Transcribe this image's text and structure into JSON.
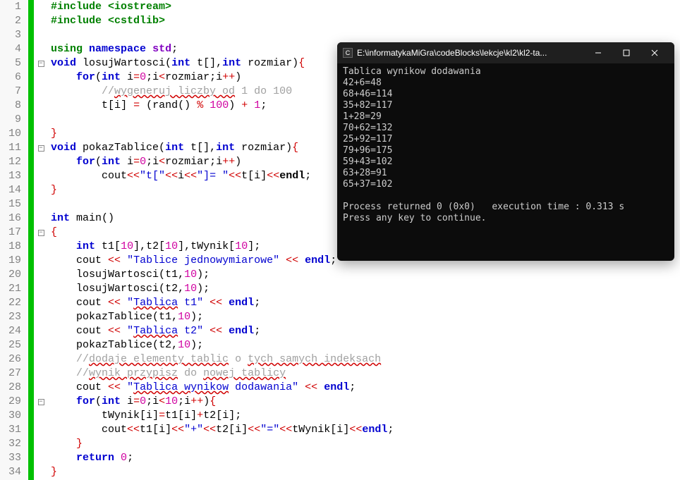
{
  "editor": {
    "lines": [
      1,
      2,
      3,
      4,
      5,
      6,
      7,
      8,
      9,
      10,
      11,
      12,
      13,
      14,
      15,
      16,
      17,
      18,
      19,
      20,
      21,
      22,
      23,
      24,
      25,
      26,
      27,
      28,
      29,
      30,
      31,
      32,
      33,
      34
    ],
    "folds": {
      "5": "−",
      "11": "−",
      "17": "−",
      "29": "−"
    },
    "code": {
      "l1_include": "#include",
      "l1_lib": "<iostream>",
      "l2_include": "#include",
      "l2_lib": "<cstdlib>",
      "l4_using": "using",
      "l4_ns": "namespace",
      "l4_std": "std",
      "l4_semi": ";",
      "l5_void": "void",
      "l5_fn": " losujWartosci",
      "l5_p1": "(",
      "l5_int1": "int",
      "l5_t": " t",
      "l5_br": "[],",
      "l5_int2": "int",
      "l5_rozmiar": " rozmiar",
      "l5_p2": ")",
      "l5_brace": "{",
      "l6_for": "for",
      "l6_p1": "(",
      "l6_int": "int",
      "l6_body": " i",
      "l6_eq": "=",
      "l6_z": "0",
      "l6_semi1": ";",
      "l6_cond": "i",
      "l6_lt": "<",
      "l6_roz": "rozmiar",
      "l6_semi2": ";",
      "l6_inc": "i",
      "l6_pp": "++",
      "l6_p2": ")",
      "l7_comment": "//wygeneruj liczby od 1 do 100",
      "l7_wavy": "wygeneruj liczby od",
      "l8_t": "t",
      "l8_br1": "[",
      "l8_i": "i",
      "l8_br2": "]",
      "l8_sp": " ",
      "l8_eq": "=",
      "l8_sp2": " ",
      "l8_p1": "(",
      "l8_rand": "rand",
      "l8_p2": "()",
      "l8_sp3": " ",
      "l8_mod": "%",
      "l8_sp4": " ",
      "l8_100": "100",
      "l8_p3": ")",
      "l8_sp5": " ",
      "l8_plus": "+",
      "l8_sp6": " ",
      "l8_1": "1",
      "l8_semi": ";",
      "l10_brace": "}",
      "l11_void": "void",
      "l11_fn": " pokazTablice",
      "l11_p1": "(",
      "l11_int1": "int",
      "l11_t": " t",
      "l11_br": "[],",
      "l11_int2": "int",
      "l11_roz": " rozmiar",
      "l11_p2": ")",
      "l11_brace": "{",
      "l12_for": "for",
      "l12_p1": "(",
      "l12_int": "int",
      "l12_body": " i",
      "l12_eq": "=",
      "l12_z": "0",
      "l12_semi1": ";",
      "l12_cond": "i",
      "l12_lt": "<",
      "l12_roz": "rozmiar",
      "l12_semi2": ";",
      "l12_inc": "i",
      "l12_pp": "++",
      "l12_p2": ")",
      "l13_cout": "cout",
      "l13_op1": "<<",
      "l13_s1": "\"t[\"",
      "l13_op2": "<<",
      "l13_i": "i",
      "l13_op3": "<<",
      "l13_s2": "\"]= \"",
      "l13_op4": "<<",
      "l13_t": "t",
      "l13_br1": "[",
      "l13_ii": "i",
      "l13_br2": "]",
      "l13_op5": "<<",
      "l13_endl": "endl",
      "l13_semi": ";",
      "l14_brace": "}",
      "l16_int": "int",
      "l16_main": " main",
      "l16_p": "()",
      "l17_brace": "{",
      "l18_int": "int",
      "l18_t1": " t1",
      "l18_b1": "[",
      "l18_10a": "10",
      "l18_b2": "],",
      "l18_t2": "t2",
      "l18_b3": "[",
      "l18_10b": "10",
      "l18_b4": "],",
      "l18_tw": "tWynik",
      "l18_b5": "[",
      "l18_10c": "10",
      "l18_b6": "];",
      "l19_cout": "cout",
      "l19_sp": " ",
      "l19_op1": "<<",
      "l19_sp2": " ",
      "l19_s": "\"Tablice jednowymiarowe\"",
      "l19_sp3": " ",
      "l19_op2": "<<",
      "l19_sp4": " ",
      "l19_endl": "endl",
      "l19_semi": ";",
      "l20_fn": "losujWartosci",
      "l20_p1": "(",
      "l20_t1": "t1",
      "l20_c": ",",
      "l20_10": "10",
      "l20_p2": ");",
      "l21_fn": "losujWartosci",
      "l21_p1": "(",
      "l21_t2": "t2",
      "l21_c": ",",
      "l21_10": "10",
      "l21_p2": ");",
      "l22_cout": "cout",
      "l22_sp": " ",
      "l22_op1": "<<",
      "l22_sp2": " ",
      "l22_s": "\"Tablica t1\"",
      "l22_wavy": "Tablica",
      "l22_sp3": " ",
      "l22_op2": "<<",
      "l22_sp4": " ",
      "l22_endl": "endl",
      "l22_semi": ";",
      "l23_fn": "pokazTablice",
      "l23_p1": "(",
      "l23_t": "t1",
      "l23_c": ",",
      "l23_10": "10",
      "l23_p2": ");",
      "l24_cout": "cout",
      "l24_sp": " ",
      "l24_op1": "<<",
      "l24_sp2": " ",
      "l24_s": "\"Tablica t2\"",
      "l24_sp3": " ",
      "l24_op2": "<<",
      "l24_sp4": " ",
      "l24_endl": "endl",
      "l24_semi": ";",
      "l25_fn": "pokazTablice",
      "l25_p1": "(",
      "l25_t": "t2",
      "l25_c": ",",
      "l25_10": "10",
      "l25_p2": ");",
      "l26_c": "//dodaje elementy tablic o tych samych indeksach",
      "l27_c": "//wynik przypisz do nowej tablicy",
      "l28_cout": "cout",
      "l28_sp": " ",
      "l28_op1": "<<",
      "l28_sp2": " ",
      "l28_s": "\"Tablica wynikow dodawania\"",
      "l28_wavy": "Tablica wynikow",
      "l28_sp3": " ",
      "l28_op2": "<<",
      "l28_sp4": " ",
      "l28_endl": "endl",
      "l28_semi": ";",
      "l29_for": "for",
      "l29_p1": "(",
      "l29_int": "int",
      "l29_body": " i",
      "l29_eq": "=",
      "l29_z": "0",
      "l29_semi1": ";",
      "l29_cond": "i",
      "l29_lt": "<",
      "l29_10": "10",
      "l29_semi2": ";",
      "l29_inc": "i",
      "l29_pp": "++",
      "l29_p2": ")",
      "l29_brace": "{",
      "l30_tw": "tWynik",
      "l30_b1": "[",
      "l30_i": "i",
      "l30_b2": "]",
      "l30_eq": "=",
      "l30_t1": "t1",
      "l30_b3": "[",
      "l30_i2": "i",
      "l30_b4": "]",
      "l30_plus": "+",
      "l30_t2": "t2",
      "l30_b5": "[",
      "l30_i3": "i",
      "l30_b6": "];",
      "l31_cout": "cout",
      "l31_op1": "<<",
      "l31_t1": "t1",
      "l31_b1": "[",
      "l31_i": "i",
      "l31_b2": "]",
      "l31_op2": "<<",
      "l31_s1": "\"+\"",
      "l31_op3": "<<",
      "l31_t2": "t2",
      "l31_b3": "[",
      "l31_i2": "i",
      "l31_b4": "]",
      "l31_op4": "<<",
      "l31_s2": "\"=\"",
      "l31_op5": "<<",
      "l31_tw": "tWynik",
      "l31_b5": "[",
      "l31_i3": "i",
      "l31_b6": "]",
      "l31_op6": "<<",
      "l31_endl": "endl",
      "l31_semi": ";",
      "l32_brace": "}",
      "l33_ret": "return",
      "l33_sp": " ",
      "l33_0": "0",
      "l33_semi": ";",
      "l34_brace": "}"
    }
  },
  "console": {
    "title": "E:\\informatykaMiGra\\codeBlocks\\lekcje\\kl2\\kl2-ta...",
    "icon_letter": "C",
    "output": [
      "Tablica wynikow dodawania",
      "42+6=48",
      "68+46=114",
      "35+82=117",
      "1+28=29",
      "70+62=132",
      "25+92=117",
      "79+96=175",
      "59+43=102",
      "63+28=91",
      "65+37=102",
      "",
      "Process returned 0 (0x0)   execution time : 0.313 s",
      "Press any key to continue."
    ]
  }
}
